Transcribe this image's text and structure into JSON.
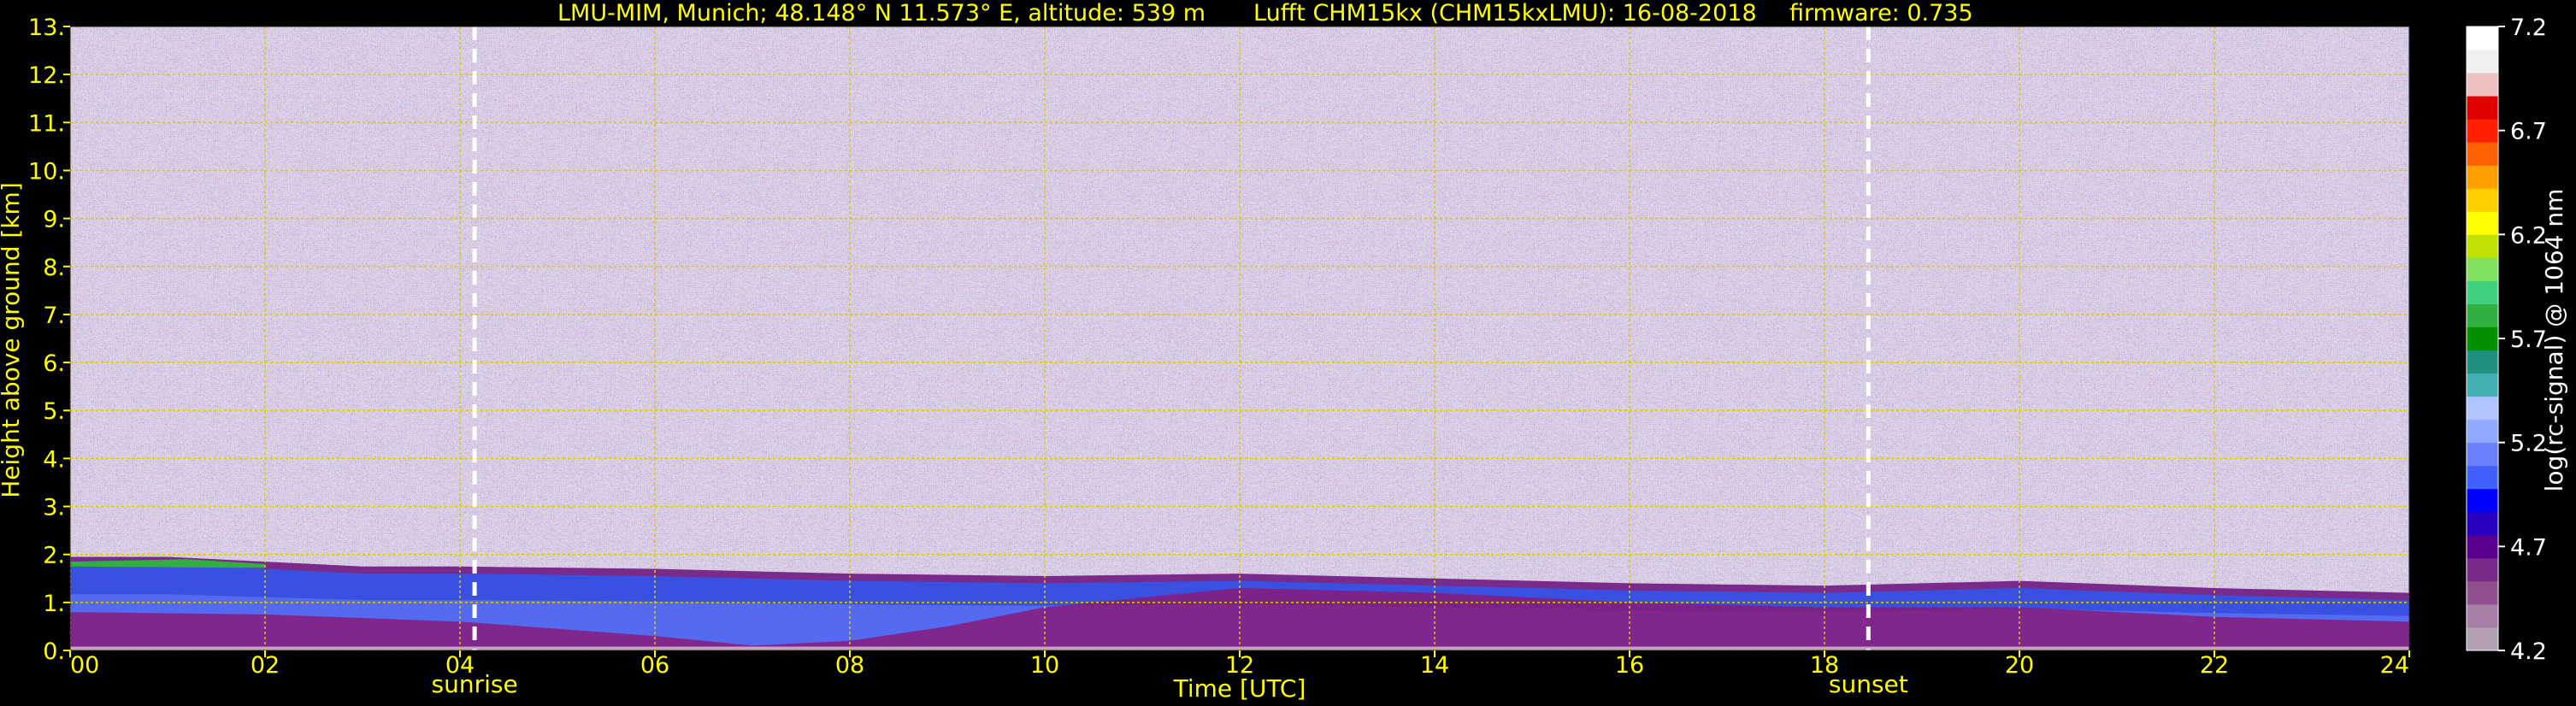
{
  "chart_data": {
    "type": "heatmap",
    "title_parts": [
      "LMU-MIM, Munich; 48.148° N 11.573° E, altitude: 539 m",
      "Lufft CHM15kx (CHM15kxLMU): 16-08-2018",
      "firmware: 0.735"
    ],
    "xlabel": "Time [UTC]",
    "ylabel": "Height above ground [km]",
    "xlim": [
      0,
      24
    ],
    "ylim": [
      0,
      13
    ],
    "x_ticks": [
      0,
      2,
      4,
      6,
      8,
      10,
      12,
      14,
      16,
      18,
      20,
      22,
      24
    ],
    "x_tick_labels": [
      "00",
      "02",
      "04",
      "06",
      "08",
      "10",
      "12",
      "14",
      "16",
      "18",
      "20",
      "22",
      "24"
    ],
    "y_ticks": [
      0,
      1,
      2,
      3,
      4,
      5,
      6,
      7,
      8,
      9,
      10,
      11,
      12,
      13
    ],
    "y_tick_labels": [
      "0.",
      "1.",
      "2.",
      "3.",
      "4.",
      "5.",
      "6.",
      "7.",
      "8.",
      "9.",
      "10.",
      "11.",
      "12.",
      "13."
    ],
    "grid": true,
    "events": [
      {
        "label": "sunrise",
        "x": 4.15
      },
      {
        "label": "sunset",
        "x": 18.45
      }
    ],
    "colorbar": {
      "label": "log(rc-signal) @ 1064 nm",
      "range": [
        4.2,
        7.2
      ],
      "ticks": [
        4.2,
        4.7,
        5.2,
        5.7,
        6.2,
        6.7,
        7.2
      ],
      "tick_labels": [
        "4.2",
        "4.7",
        "5.2",
        "5.7",
        "6.2",
        "6.7",
        "7.2"
      ],
      "colors": [
        "#b4a0b4",
        "#a680a6",
        "#905090",
        "#7a2a8a",
        "#5a0090",
        "#2a00c0",
        "#0000ff",
        "#4060ff",
        "#6a80ff",
        "#90a8ff",
        "#b0c4ff",
        "#40b0b0",
        "#209080",
        "#009000",
        "#30b040",
        "#40d080",
        "#80e060",
        "#c0e000",
        "#ffff00",
        "#ffd000",
        "#ffa000",
        "#ff6000",
        "#ff2000",
        "#e00000",
        "#f0c0c0",
        "#f0f0f0",
        "#ffffff"
      ]
    },
    "layers": [
      {
        "name": "noise",
        "desc": "speckled purple/gray noise above boundary layer"
      },
      {
        "name": "boundary_layer_top_km",
        "x": [
          0,
          1,
          2,
          3,
          4,
          6,
          8,
          10,
          12,
          14,
          16,
          18,
          20,
          22,
          24
        ],
        "y": [
          1.95,
          1.95,
          1.85,
          1.75,
          1.75,
          1.7,
          1.6,
          1.55,
          1.6,
          1.5,
          1.4,
          1.35,
          1.45,
          1.3,
          1.2
        ]
      },
      {
        "name": "residual_layer_top_km",
        "x": [
          0,
          2,
          4,
          6,
          7,
          8,
          9,
          10,
          12,
          14,
          16,
          18,
          20,
          22,
          24
        ],
        "y": [
          0.8,
          0.75,
          0.6,
          0.3,
          0.1,
          0.2,
          0.5,
          0.9,
          1.3,
          1.2,
          1.0,
          0.9,
          0.9,
          0.7,
          0.6
        ]
      }
    ]
  }
}
